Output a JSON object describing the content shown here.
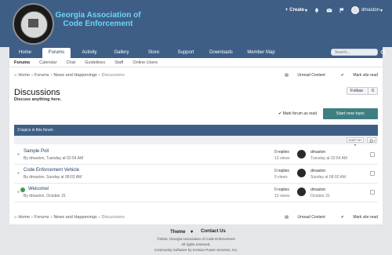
{
  "site": {
    "title": "Georgia Association of Code Enforcement"
  },
  "user_bar": {
    "create_label": "Create",
    "username": "dmaston"
  },
  "nav": {
    "tabs": [
      "Home",
      "Forums",
      "Activity",
      "Gallery",
      "Store",
      "Support",
      "Downloads",
      "Member Map"
    ],
    "active": "Forums",
    "search_placeholder": "Search..."
  },
  "sub_nav": {
    "items": [
      "Forums",
      "Calendar",
      "Chat",
      "Guidelines",
      "Staff",
      "Online Users"
    ],
    "active": "Forums"
  },
  "breadcrumb": {
    "items": [
      "Home",
      "Forums",
      "News and Happenings",
      "Discussions"
    ],
    "unread": "Unread Content",
    "mark_read": "Mark site read"
  },
  "page": {
    "title": "Discussions",
    "description": "Discuss anything here.",
    "follow_label": "Follow",
    "follow_count": "0",
    "mark_forum_read": "Mark forum as read",
    "start_topic": "Start new topic",
    "topics_count_label": "3 topics in this forum",
    "sort_label": "SORT BY"
  },
  "topics": [
    {
      "title": "Sample Poll",
      "meta": "By dmaston, Tuesday at 02:54 AM",
      "replies": "0 replies",
      "views": "13 views",
      "last_user": "dmaston",
      "last_date": "Tuesday at 02:54 AM",
      "pinned_globe": false
    },
    {
      "title": "Code Enforcement Vehicle",
      "meta": "By dmaston, Sunday at 08:02 AM",
      "replies": "0 replies",
      "views": "9 views",
      "last_user": "dmaston",
      "last_date": "Sunday at 08:02 AM",
      "pinned_globe": false
    },
    {
      "title": "Welcome!",
      "meta": "By dmaston, October 31",
      "replies": "0 replies",
      "views": "10 views",
      "last_user": "dmaston",
      "last_date": "October 31",
      "pinned_globe": true
    }
  ],
  "footer": {
    "theme": "Theme",
    "contact": "Contact Us",
    "copyright": "©2016, Georgia Association of Code Enforcement",
    "rights": "All rights reserved.",
    "powered": "Community Software by Invision Power Services, Inc."
  },
  "colors": {
    "header_bg": "#3e5e86",
    "accent_title": "#6cd4f5",
    "start_btn": "#3f7f82"
  }
}
